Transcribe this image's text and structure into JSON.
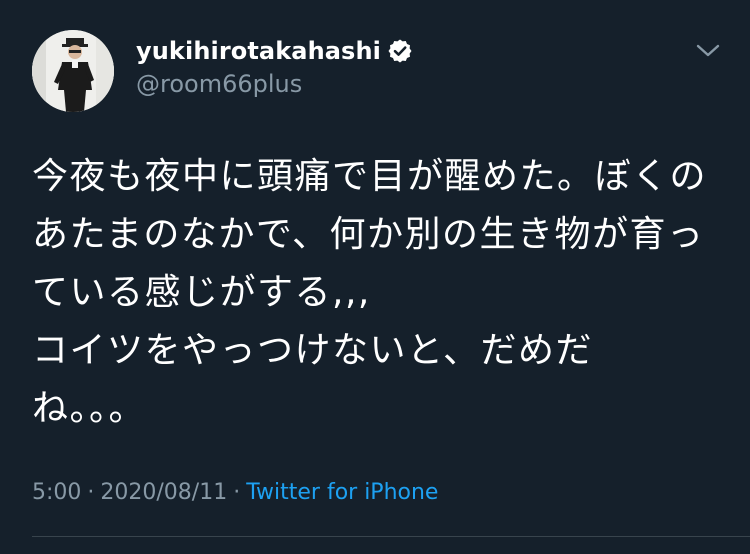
{
  "tweet": {
    "display_name": "yukihirotakahashi",
    "handle": "@room66plus",
    "verified": true,
    "text": "今夜も夜中に頭痛で目が醒めた。ぼくの\nあたまのなかで、何か別の生き物が育っ\nている感じがする,,,\nコイツをやっつけないと、だめだ\nね。。。",
    "time": "5:00",
    "separator": "·",
    "date": "2020/08/11",
    "source": "Twitter for iPhone"
  },
  "icons": {
    "verified": "verified-badge-icon",
    "menu": "chevron-down-icon"
  },
  "colors": {
    "background": "#15202b",
    "text_primary": "#ffffff",
    "text_secondary": "#8899a6",
    "accent": "#1da1f2",
    "divider": "#38444d"
  }
}
